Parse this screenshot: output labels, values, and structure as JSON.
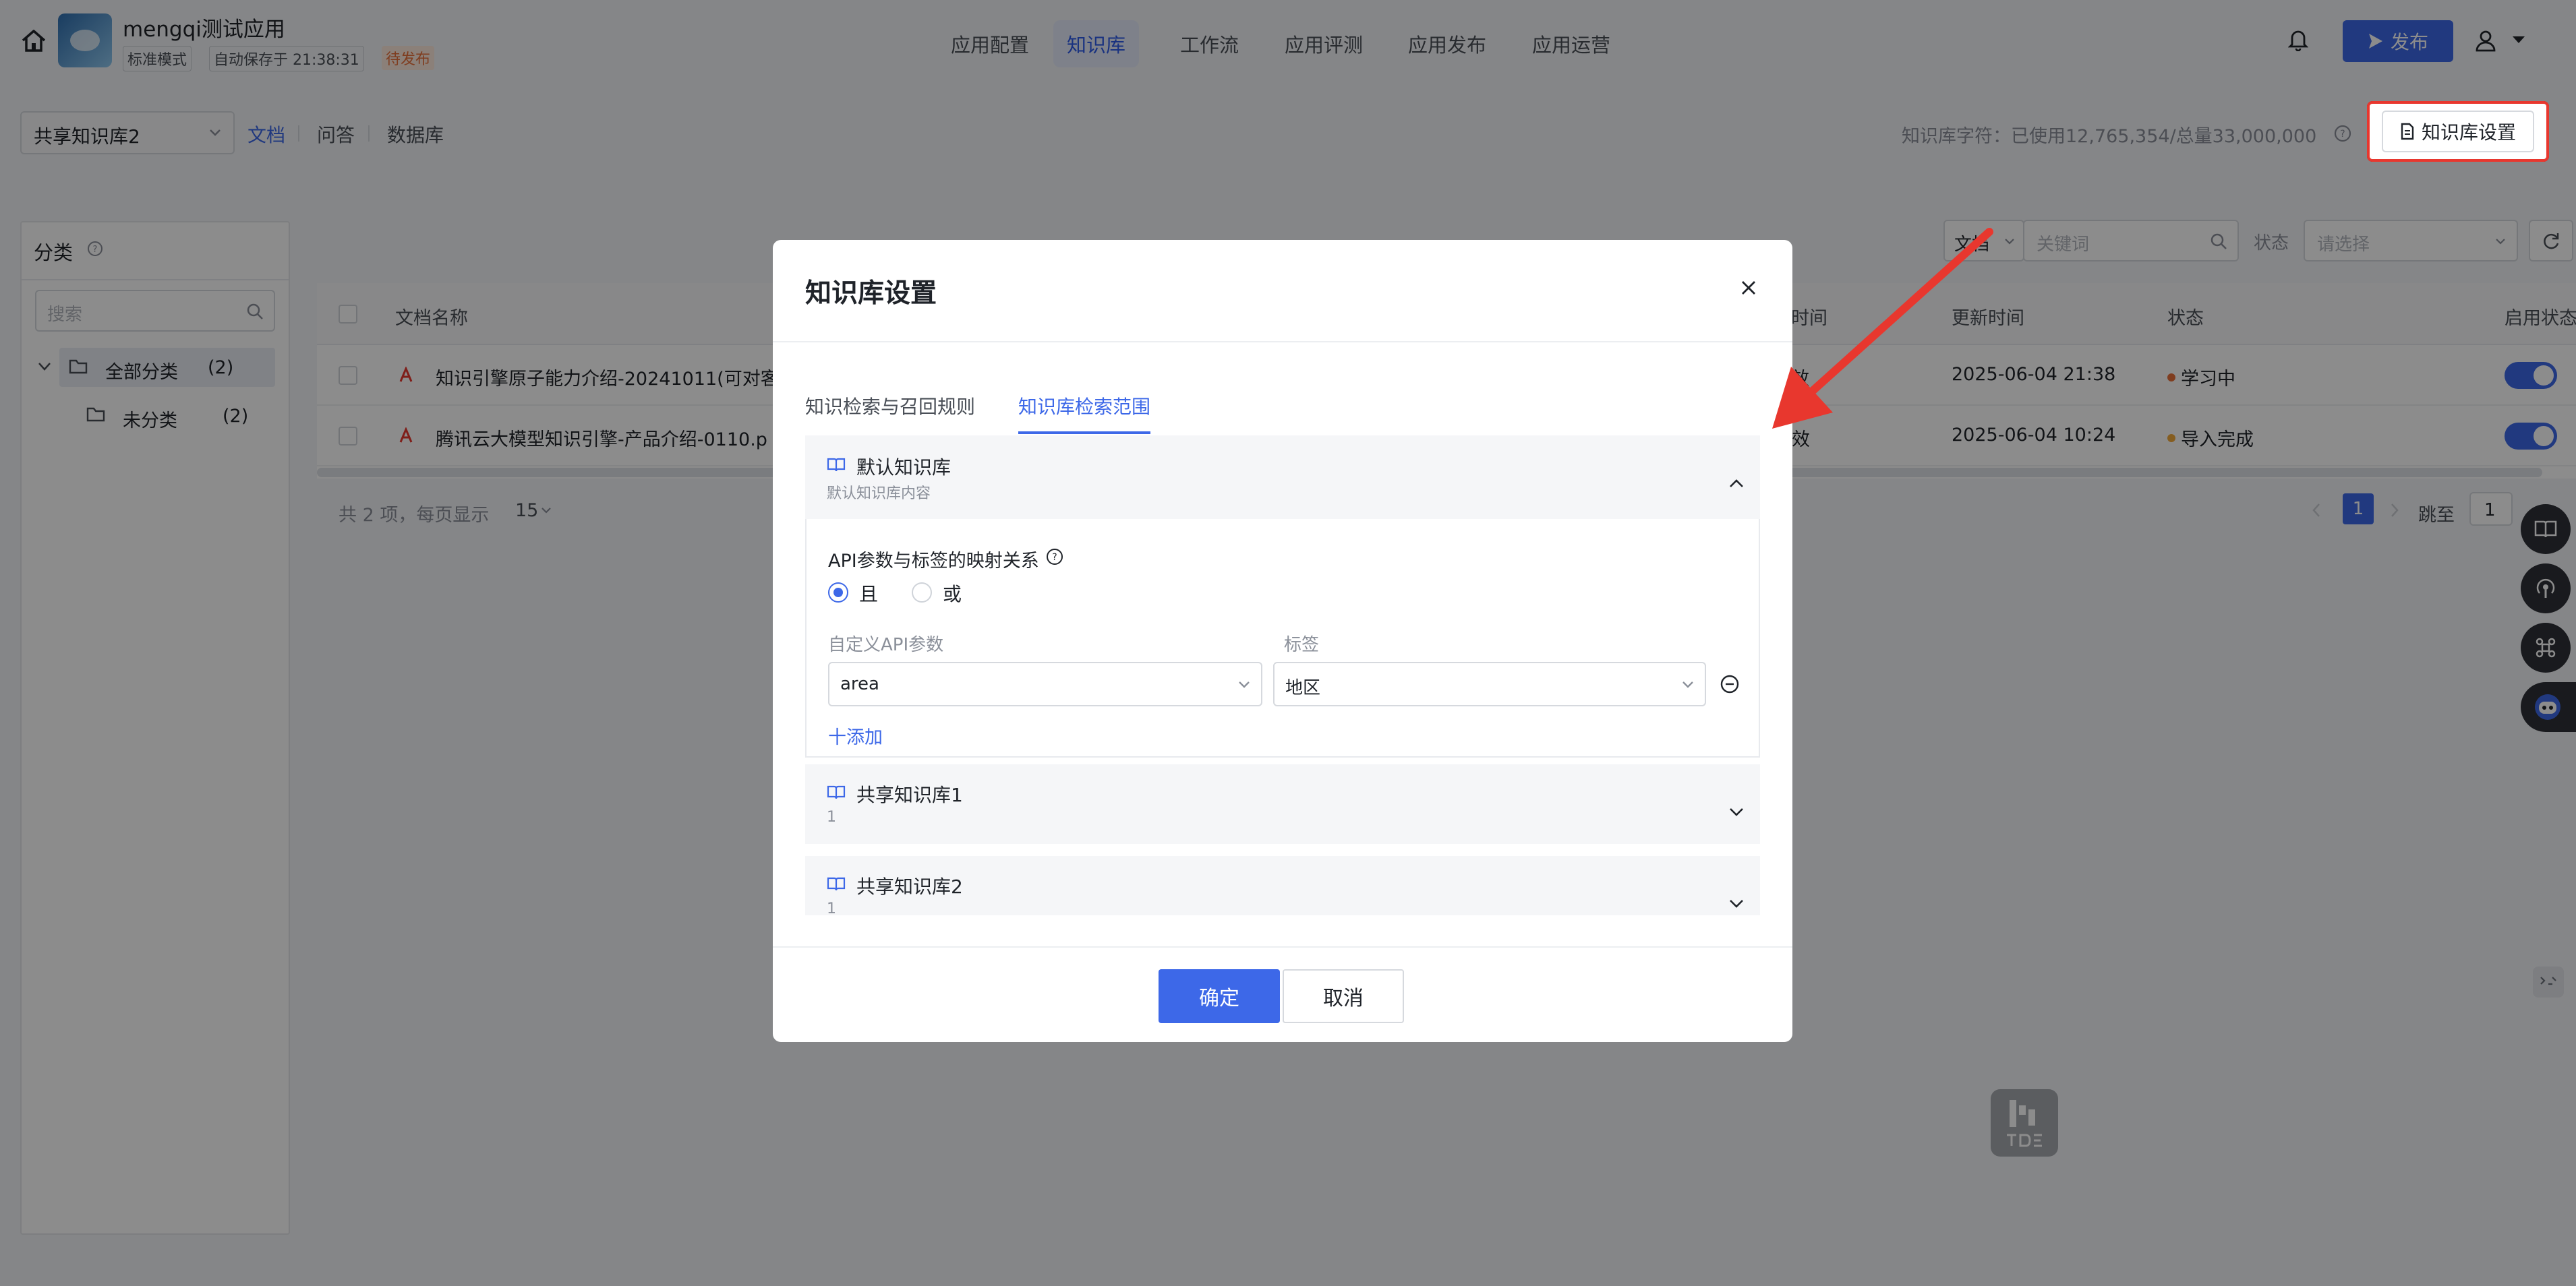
{
  "header": {
    "app_name": "mengqi测试应用",
    "mode_tag": "标准模式",
    "autosave": "自动保存于 21:38:31",
    "status_tag": "待发布",
    "nav_tabs": [
      "应用配置",
      "知识库",
      "工作流",
      "应用评测",
      "应用发布",
      "应用运营"
    ],
    "publish_label": "发布"
  },
  "subbar": {
    "kb_select": "共享知识库2",
    "tabs": [
      "文档",
      "问答",
      "数据库"
    ],
    "usage_text": "知识库字符：已使用12,765,354/总量33,000,000",
    "settings_button": "知识库设置"
  },
  "sidebar": {
    "title": "分类",
    "search_placeholder": "搜索",
    "tree": [
      {
        "label": "全部分类",
        "count": "(2)"
      },
      {
        "label": "未分类",
        "count": "(2)"
      }
    ]
  },
  "filter": {
    "type_select": "文档",
    "keyword_placeholder": "关键词",
    "status_label": "状态",
    "status_placeholder": "请选择"
  },
  "table": {
    "columns": {
      "name": "文档名称",
      "time": "时间",
      "updated": "更新时间",
      "status": "状态",
      "enable": "启用状态"
    },
    "rows": [
      {
        "name": "知识引擎原子能力介绍-20241011(可对客",
        "validity": "效",
        "updated": "2025-06-04 21:38",
        "status": "学习中",
        "status_color": "#e8703a"
      },
      {
        "name": "腾讯云大模型知识引擎-产品介绍-0110.p",
        "validity": "有效",
        "updated": "2025-06-04 10:24",
        "status": "导入完成",
        "status_color": "#f2a93b"
      }
    ],
    "footer_text": "共 2 项，每页显示",
    "page_size": "15",
    "current_page": "1",
    "jump_label": "跳至",
    "jump_value": "1"
  },
  "modal": {
    "title": "知识库设置",
    "tabs": [
      "知识检索与召回规则",
      "知识库检索范围"
    ],
    "default_kb": {
      "name": "默认知识库",
      "desc": "默认知识库内容"
    },
    "mapping_title": "API参数与标签的映射关系",
    "radio_and": "且",
    "radio_or": "或",
    "col_api": "自定义API参数",
    "col_tag": "标签",
    "api_value": "area",
    "tag_value": "地区",
    "add_label": "十添加",
    "shared_kbs": [
      {
        "name": "共享知识库1",
        "desc": "1"
      },
      {
        "name": "共享知识库2",
        "desc": "1"
      }
    ],
    "ok_label": "确定",
    "cancel_label": "取消"
  },
  "colors": {
    "accent": "#3d68e8",
    "red_box": "#e8372e",
    "status_orange": "#e8703a"
  }
}
